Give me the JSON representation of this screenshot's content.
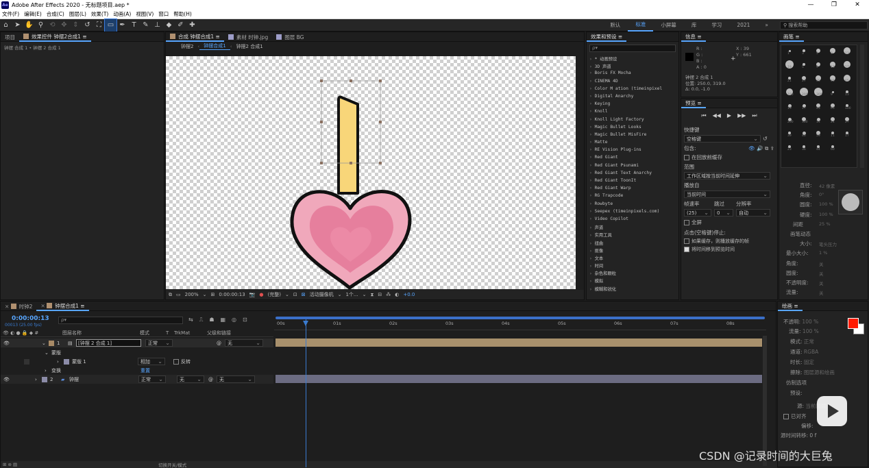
{
  "window": {
    "title": "Adobe After Effects 2020 - 无标题项目.aep *",
    "logo": "Ae",
    "minimize": "—",
    "restore": "❐",
    "close": "✕"
  },
  "menu": [
    "文件(F)",
    "编辑(E)",
    "合成(C)",
    "图层(L)",
    "效果(T)",
    "动画(A)",
    "视图(V)",
    "窗口",
    "帮助(H)"
  ],
  "toolbar": {
    "tools": [
      "home-icon",
      "selection-tool-icon",
      "hand-tool-icon",
      "zoom-tool-icon",
      "orbit-camera-icon",
      "track-xy-camera-icon",
      "track-z-camera-icon",
      "rotate-tool-icon",
      "pan-behind-icon",
      "rectangle-tool-icon",
      "pen-tool-icon",
      "type-tool-icon",
      "brush-tool-icon",
      "clone-stamp-icon",
      "eraser-icon",
      "roto-brush-icon",
      "puppet-pin-icon"
    ],
    "workspaces": [
      "默认",
      "标准",
      "小屏幕",
      "库",
      "学习",
      "2021"
    ],
    "active_workspace": "标准",
    "more": "»",
    "help_search": "搜索帮助"
  },
  "project_panel": {
    "tab_project": "项目",
    "tab_effects": "效果控件 钟摆2合成1",
    "breadcrumb": "钟摆 合成 1 • 钟摆 2 合成 1"
  },
  "comp_panel": {
    "tab_comp": "合成 钟摆合成1",
    "tab_footage": "素材 时钟.jpg",
    "tab_layer": "图层 BG",
    "subtabs": [
      "钟摆2",
      "钟摆合成1",
      "钟摆2 合成1"
    ],
    "active_subtab": "钟摆合成1",
    "footer": {
      "zoom": "200%",
      "timecode": "0:00:00:13",
      "resolution": "(完整)",
      "camera": "活动摄像机",
      "views": "1个...",
      "exposure": "+0.0"
    }
  },
  "effects_presets": {
    "title": "效果和预设",
    "items": [
      "* 动画预设",
      "3D 声道",
      "Boris FX Mocha",
      "CINEMA 4D",
      "Color M    ation (timeinpixel",
      "Digital Anarchy",
      "Keying",
      "Knoll",
      "Knoll Light Factory",
      "Magic Bullet Looks",
      "Magic Bullet MisFire",
      "Matte",
      "RE Vision Plug-ins",
      "Red Giant",
      "Red Giant Psunami",
      "Red Giant Text Anarchy",
      "Red Giant ToonIt",
      "Red Giant Warp",
      "RG Trapcode",
      "Rowbyte",
      "Seepex (timeinpixels.com)",
      "Video Copilot",
      "声道",
      "实用工具",
      "扭曲",
      "抠像",
      "文本",
      "时间",
      "杂色和颗粒",
      "模拟",
      "模糊和锐化"
    ]
  },
  "info_panel": {
    "title": "信息",
    "r_label": "R :",
    "g_label": "G :",
    "b_label": "B :",
    "a_label": "A : 0",
    "x": "X : 39",
    "y": "Y : 661",
    "layer": "钟摆 2 合成 1",
    "position": "位置: 250.0, 319.0",
    "delta": "Δ: 0.0, -1.0"
  },
  "preview_panel": {
    "title": "预览",
    "controls": [
      "skip-first-icon",
      "prev-frame-icon",
      "play-icon",
      "next-frame-icon",
      "skip-last-icon"
    ],
    "shortcut_label": "快捷键",
    "shortcut_value": "空格键",
    "include_label": "包含:",
    "cache_label": "在回放前缓存",
    "range_label": "范围",
    "range_value": "工作区域按当前时间延伸",
    "play_from_label": "播放自",
    "play_from_value": "当前时间",
    "frame_rate_label": "帧速率",
    "skip_label": "跳过",
    "res_label": "分辨率",
    "frame_rate_value": "(25)",
    "skip_value": "0",
    "res_value": "自动",
    "fullscreen_label": "全屏",
    "stop_label": "点击(空格键)停止:",
    "opt1": "如果缓存，则播放缓存的帧",
    "opt2": "将时间移到预览时间"
  },
  "brush_panel": {
    "title": "画笔",
    "row_sizes": [
      "1",
      "3",
      "5",
      "9",
      "13",
      "19",
      "5",
      "9",
      "13",
      "17",
      "21",
      "27",
      "35",
      "45",
      "65",
      "100",
      "200",
      "300",
      "9",
      "13",
      "19",
      "17",
      "45",
      "65",
      "100",
      "200",
      "300",
      "14",
      "24",
      "27",
      "39",
      "46",
      "59",
      "11",
      "17",
      "23",
      "36",
      "44",
      "60"
    ],
    "props": [
      {
        "label": "直径:",
        "value": "42 像素"
      },
      {
        "label": "角度:",
        "value": "0°"
      },
      {
        "label": "圆度:",
        "value": "100 %"
      },
      {
        "label": "硬度:",
        "value": "100 %"
      },
      {
        "label": "间距",
        "value": "25 %"
      },
      {
        "label": "画笔动态",
        "value": ""
      },
      {
        "label": "大小:",
        "value": "笔头压力"
      },
      {
        "label": "最小大小:",
        "value": "1 %"
      },
      {
        "label": "角度:",
        "value": "关"
      },
      {
        "label": "圆度:",
        "value": "关"
      },
      {
        "label": "不透明度:",
        "value": "关"
      },
      {
        "label": "流量:",
        "value": "关"
      }
    ]
  },
  "paint_panel": {
    "title": "绘画",
    "opacity": {
      "label": "不透明:",
      "value": "100 %"
    },
    "flow": {
      "label": "流量:",
      "value": "100 %"
    },
    "mode": {
      "label": "模式:",
      "value": "正常"
    },
    "channel": {
      "label": "通道:",
      "value": "RGBA"
    },
    "duration": {
      "label": "时长:",
      "value": "固定"
    },
    "erase": {
      "label": "擦除:",
      "value": "图层源和绘画"
    },
    "clone": {
      "label": "仿制选项"
    },
    "preset_label": "预设:",
    "source_label": "源:",
    "source_value": "当前图层",
    "aligned": "已对齐",
    "offset_label": "偏移:",
    "source_time": "源时间转移: 0 f",
    "fg_color": "#ff1a00",
    "bg_color": "#ffffff"
  },
  "timeline": {
    "tabs": [
      "时钟2",
      "钟摆合成1"
    ],
    "active_tab": "钟摆合成1",
    "timecode": "0:00:00:13",
    "fps": "00013 (25.00 fps)",
    "search_placeholder": "ρ▾",
    "headers": {
      "name": "图层名称",
      "mode": "模式",
      "t": "T",
      "trkmat": "TrkMat",
      "parent": "父级和链接"
    },
    "layers": [
      {
        "num": "1",
        "name": "[钟摆 2 合成 1]",
        "mode": "正常",
        "parent": "无",
        "color": "#a88a66"
      },
      {
        "num": "2",
        "name": "钟摆",
        "mode": "正常",
        "trkmat": "无",
        "parent": "无",
        "color": "#8c8ca8"
      }
    ],
    "effects_label": "蒙版",
    "mask_label": "蒙版 1",
    "mask_mode": "相加",
    "mask_invert": "反转",
    "transform_label": "变换",
    "transform_reset": "重置",
    "ruler": [
      "00s",
      "01s",
      "02s",
      "03s",
      "04s",
      "05s",
      "06s",
      "07s",
      "08s"
    ],
    "toggle_label": "切换开关/模式",
    "playhead_time_fraction": 0.054
  },
  "watermark": "CSDN @记录时间的大巨兔",
  "play_overlay": "play-button-icon"
}
